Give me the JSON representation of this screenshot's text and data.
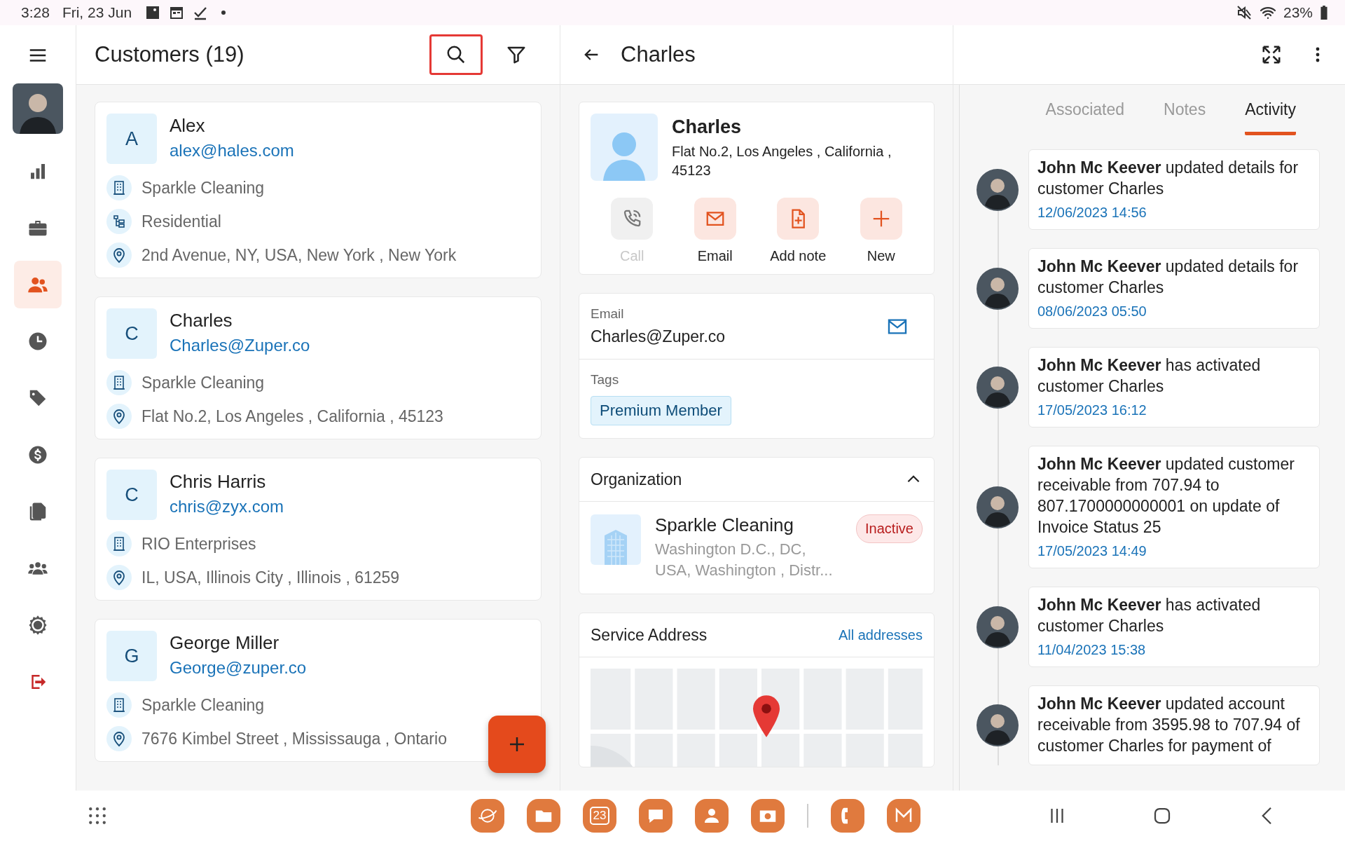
{
  "status_bar": {
    "time": "3:28",
    "date": "Fri, 23 Jun",
    "battery": "23%"
  },
  "sidebar": {
    "items": [
      {
        "kind": "chart",
        "selected": false
      },
      {
        "kind": "briefcase",
        "selected": false
      },
      {
        "kind": "people",
        "selected": true
      },
      {
        "kind": "clock",
        "selected": false
      },
      {
        "kind": "tag",
        "selected": false
      },
      {
        "kind": "dollar",
        "selected": false
      },
      {
        "kind": "documents",
        "selected": false
      },
      {
        "kind": "group",
        "selected": false
      },
      {
        "kind": "gear",
        "selected": false
      },
      {
        "kind": "logout",
        "selected": false
      }
    ]
  },
  "customer_list": {
    "title": "Customers (19)",
    "search_highlighted": true,
    "customers": [
      {
        "initial": "A",
        "name": "Alex",
        "email": "alex@hales.com",
        "details": [
          {
            "kind": "company",
            "text": "Sparkle Cleaning"
          },
          {
            "kind": "type",
            "text": "Residential"
          },
          {
            "kind": "address",
            "text": "2nd Avenue, NY, USA, New York , New York"
          }
        ]
      },
      {
        "initial": "C",
        "name": "Charles",
        "email": "Charles@Zuper.co",
        "details": [
          {
            "kind": "company",
            "text": "Sparkle Cleaning"
          },
          {
            "kind": "address",
            "text": "Flat No.2, Los Angeles , California , 45123"
          }
        ]
      },
      {
        "initial": "C",
        "name": "Chris Harris",
        "email": "chris@zyx.com",
        "details": [
          {
            "kind": "company",
            "text": "RIO Enterprises"
          },
          {
            "kind": "address",
            "text": "IL, USA, Illinois City , Illinois , 61259"
          }
        ]
      },
      {
        "initial": "G",
        "name": "George Miller",
        "email": "George@zuper.co",
        "details": [
          {
            "kind": "company",
            "text": "Sparkle Cleaning"
          },
          {
            "kind": "address",
            "text": "7676 Kimbel Street , Mississauga , Ontario"
          }
        ]
      }
    ]
  },
  "detail": {
    "title": "Charles",
    "profile": {
      "name": "Charles",
      "address": "Flat No.2, Los Angeles , California , 45123"
    },
    "actions": [
      {
        "kind": "call",
        "label": "Call",
        "disabled": true
      },
      {
        "kind": "email",
        "label": "Email",
        "disabled": false
      },
      {
        "kind": "note",
        "label": "Add note",
        "disabled": false
      },
      {
        "kind": "new",
        "label": "New",
        "disabled": false
      }
    ],
    "email": {
      "label": "Email",
      "value": "Charles@Zuper.co"
    },
    "tags": {
      "label": "Tags",
      "items": [
        "Premium Member"
      ]
    },
    "organization": {
      "title": "Organization",
      "expanded": true,
      "name": "Sparkle Cleaning",
      "address": "Washington D.C., DC, USA, Washington , Distr...",
      "status": "Inactive"
    },
    "service_address": {
      "title": "Service Address",
      "link": "All addresses"
    }
  },
  "activity_panel": {
    "tabs": [
      {
        "label": "Associated",
        "selected": false
      },
      {
        "label": "Notes",
        "selected": false
      },
      {
        "label": "Activity",
        "selected": true
      }
    ],
    "activities": [
      {
        "text": "**John Mc Keever** updated details for customer Charles",
        "time": "12/06/2023 14:56"
      },
      {
        "text": "**John Mc Keever** updated details for customer Charles",
        "time": "08/06/2023 05:50"
      },
      {
        "text": "**John Mc Keever** has activated customer Charles",
        "time": "17/05/2023 16:12"
      },
      {
        "text": "**John Mc Keever** updated customer receivable from 707.94 to 807.1700000000001 on update of Invoice Status 25",
        "time": "17/05/2023 14:49"
      },
      {
        "text": "**John Mc Keever** has activated customer Charles",
        "time": "11/04/2023 15:38"
      },
      {
        "text": "**John Mc Keever**  updated account receivable from 3595.98 to 707.94 of customer Charles  for payment of"
      }
    ]
  },
  "dock": {
    "apps": [
      {
        "kind": "browser"
      },
      {
        "kind": "files"
      },
      {
        "kind": "calendar",
        "label": "23"
      },
      {
        "kind": "messages"
      },
      {
        "kind": "contacts"
      },
      {
        "kind": "camera"
      },
      {
        "kind": "phone"
      },
      {
        "kind": "mail"
      }
    ]
  },
  "nav": [
    {
      "kind": "recents"
    },
    {
      "kind": "home"
    },
    {
      "kind": "back"
    }
  ]
}
